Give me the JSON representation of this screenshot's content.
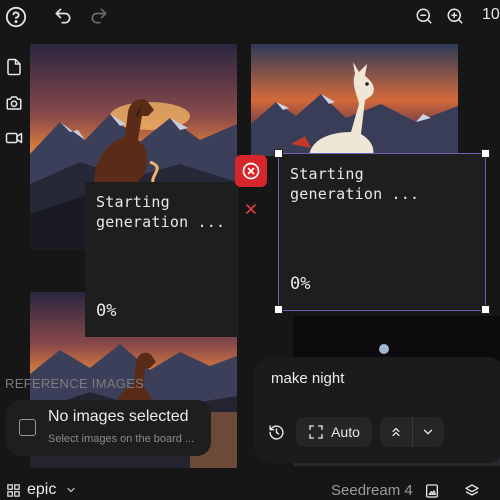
{
  "topbar": {
    "zoom_text": "10"
  },
  "icons": {
    "help": "help-circle-icon",
    "undo": "undo-icon",
    "redo": "redo-icon",
    "zoom_out": "zoom-out-icon",
    "zoom_in": "zoom-in-icon",
    "document": "document-icon",
    "camera": "camera-icon",
    "video": "video-icon",
    "cancel": "cancel-circle-icon",
    "close": "close-x-icon",
    "history": "history-icon",
    "expand": "expand-icon",
    "chevrons_up": "chevrons-up-icon",
    "chevron_down": "chevron-down-icon",
    "grid": "grid-icon",
    "image_generate": "image-sparkle-icon",
    "layers": "layers-icon"
  },
  "cards": [
    {
      "status": "Starting\ngeneration ...",
      "progress": "0%"
    },
    {
      "status": "Starting\ngeneration ...",
      "progress": "0%"
    }
  ],
  "reference": {
    "header": "REFERENCE IMAGES",
    "title": "No images selected",
    "subtitle": "Select images on the board ..."
  },
  "prompt": {
    "text": "make night",
    "auto_label": "Auto"
  },
  "bottombar": {
    "board_name": "epic",
    "model_name": "Seedream 4"
  },
  "colors": {
    "background": "#161616",
    "panel": "#1e1e1e",
    "accent_red": "#d7262b",
    "selection": "#6a63b8"
  }
}
